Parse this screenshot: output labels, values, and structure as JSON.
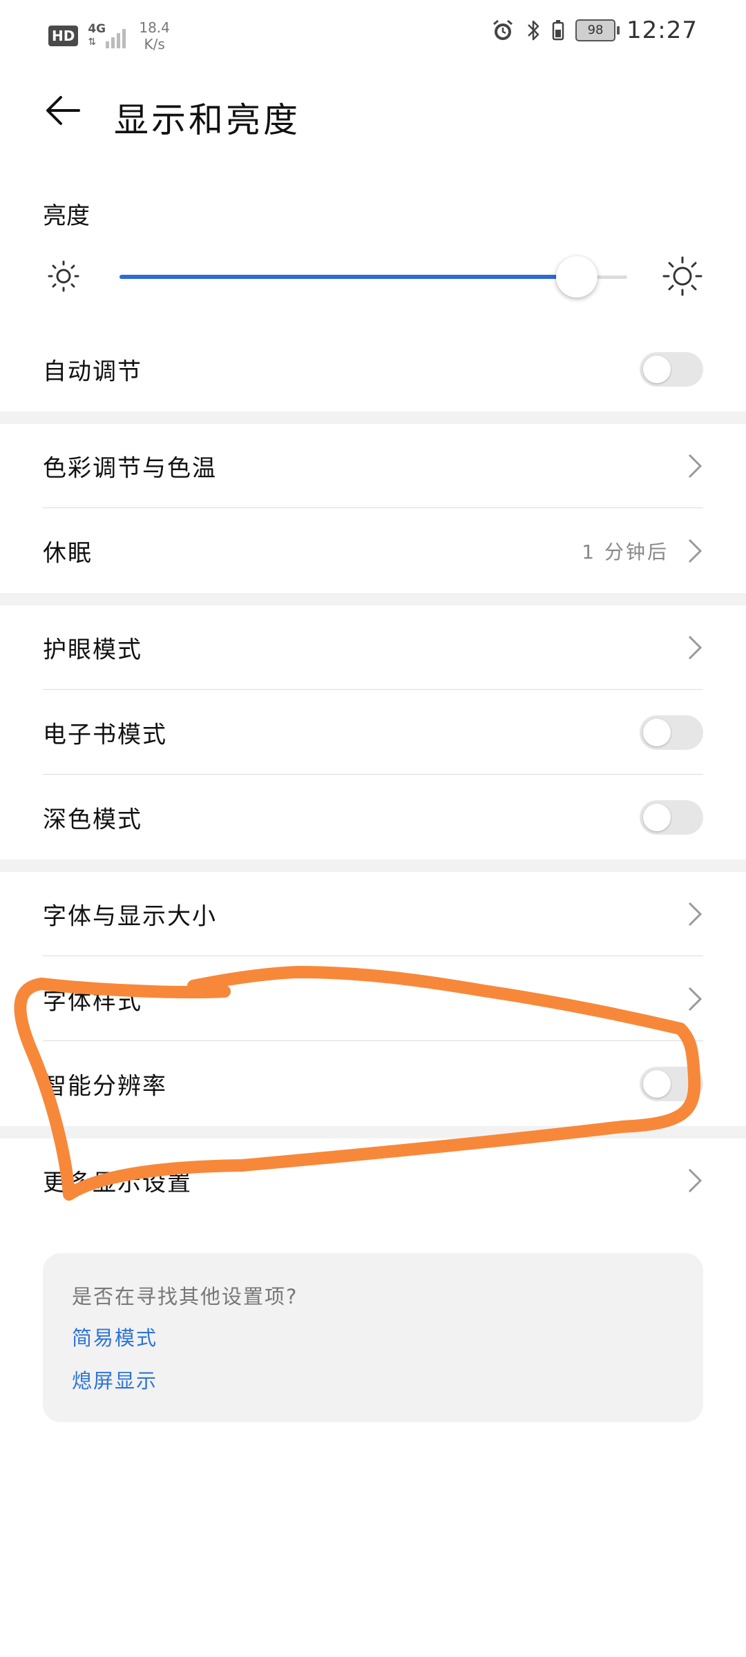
{
  "status_bar": {
    "hd": "HD",
    "network": "4G",
    "speed_value": "18.4",
    "speed_unit": "K/s",
    "battery": "98",
    "time": "12:27"
  },
  "header": {
    "title": "显示和亮度"
  },
  "brightness": {
    "label": "亮度",
    "level_percent": 90
  },
  "rows": {
    "auto_adjust": {
      "label": "自动调节",
      "on": false
    },
    "color_temp": {
      "label": "色彩调节与色温"
    },
    "sleep": {
      "label": "休眠",
      "value": "1 分钟后"
    },
    "eye_comfort": {
      "label": "护眼模式"
    },
    "ebook": {
      "label": "电子书模式",
      "on": false
    },
    "dark": {
      "label": "深色模式",
      "on": false
    },
    "font_size": {
      "label": "字体与显示大小"
    },
    "font_style": {
      "label": "字体样式"
    },
    "smart_resolution": {
      "label": "智能分辨率",
      "on": false
    },
    "more": {
      "label": "更多显示设置"
    }
  },
  "suggestions": {
    "question": "是否在寻找其他设置项?",
    "links": [
      "简易模式",
      "熄屏显示"
    ]
  },
  "colors": {
    "accent": "#2c6bd6",
    "link": "#2e74d8",
    "annotation": "#f7883a"
  },
  "icons": [
    "back-arrow-icon",
    "alarm-icon",
    "bluetooth-icon",
    "sun-dim-icon",
    "sun-bright-icon",
    "chevron-right-icon"
  ]
}
